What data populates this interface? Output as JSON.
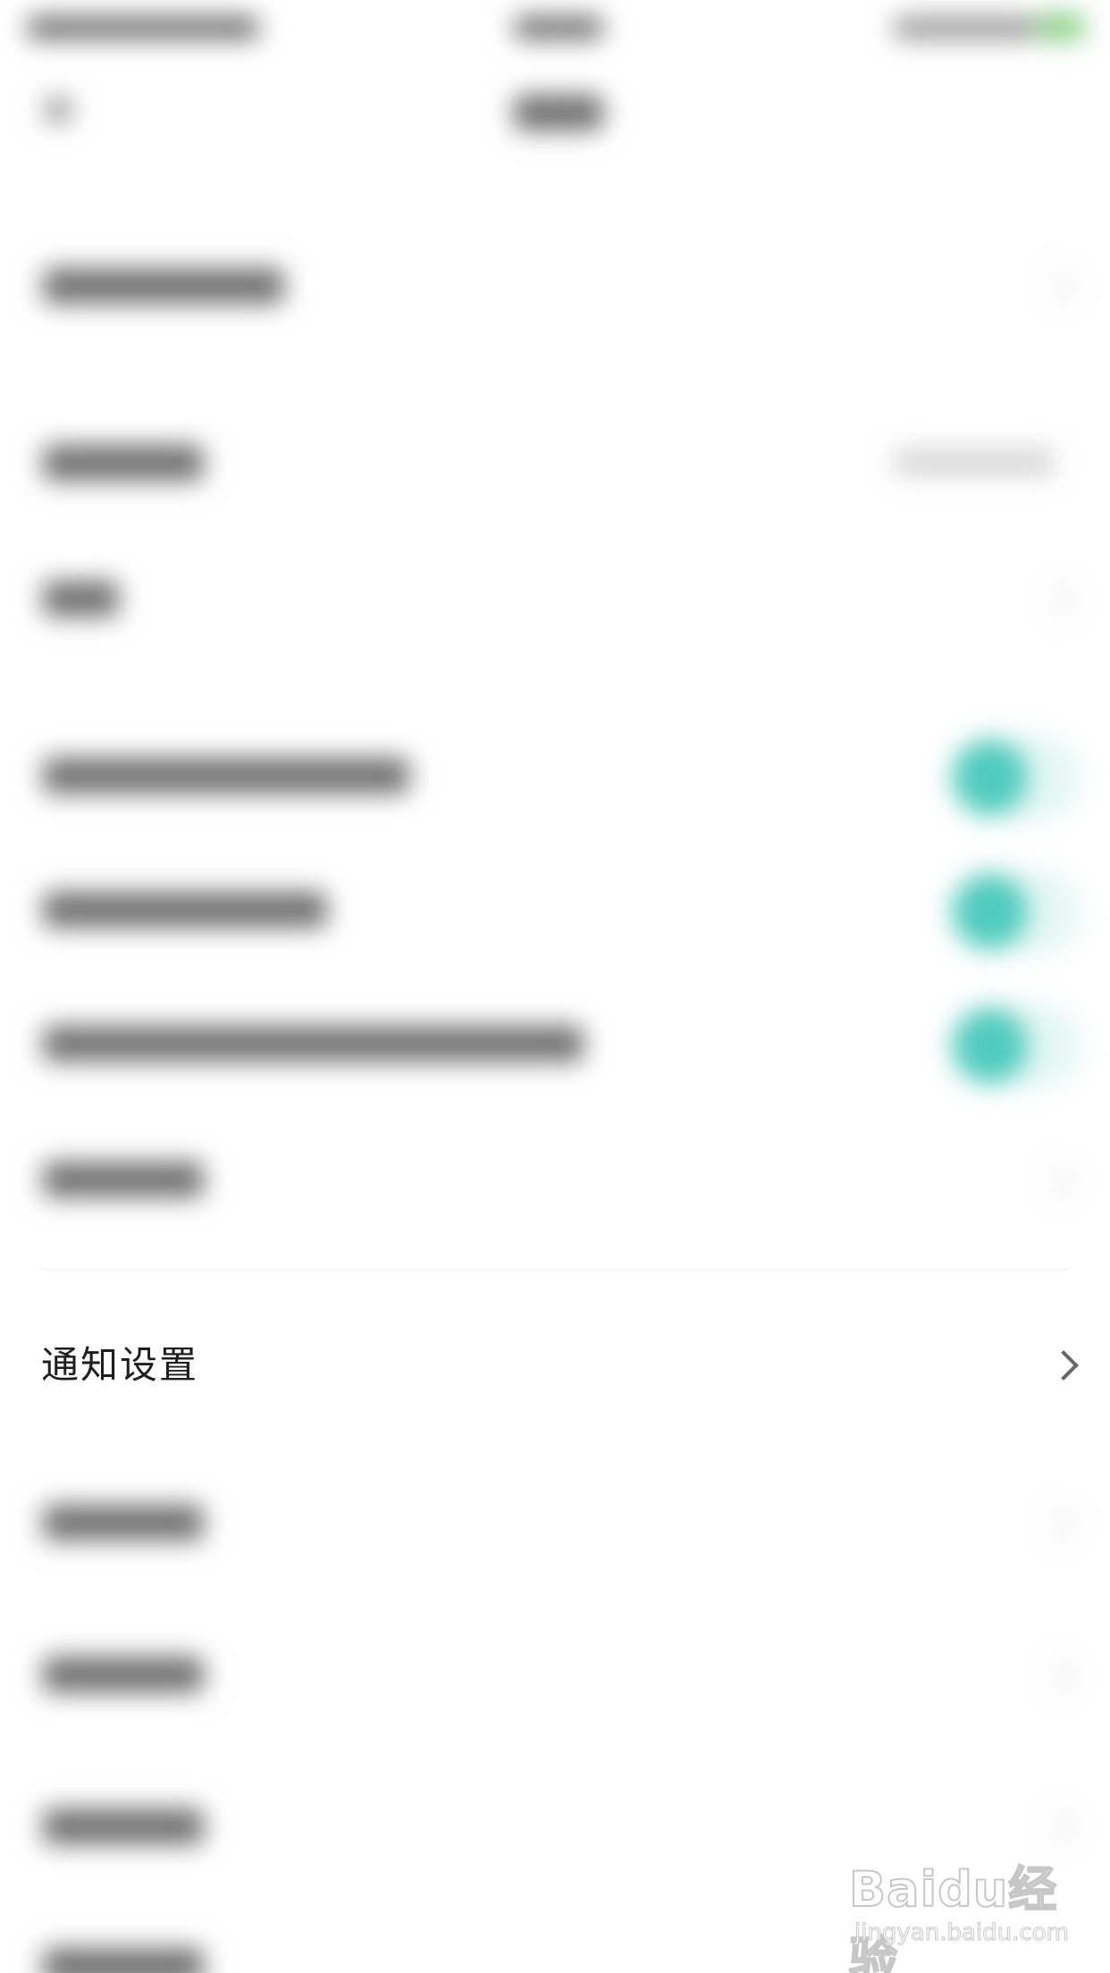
{
  "settings": {
    "notification_label": "通知设置"
  },
  "watermark": {
    "logo_text": "Baidu经验",
    "url_text": "jingyan.baidu.com"
  },
  "colors": {
    "toggle_on": "#4fcbbd",
    "toggle_track": "#e4f7f4",
    "status_battery": "#8ed18a",
    "text_primary": "#1e1e1e",
    "chevron": "#666666"
  },
  "icons": {
    "row_chevron": "chevron-right-icon"
  }
}
